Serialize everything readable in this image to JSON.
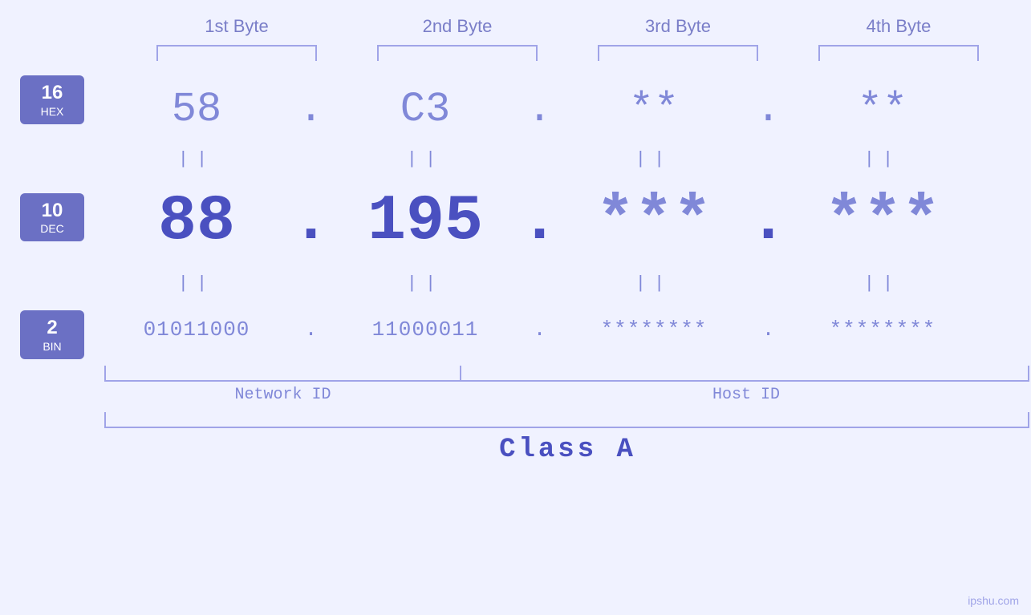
{
  "headers": {
    "byte1": "1st Byte",
    "byte2": "2nd Byte",
    "byte3": "3rd Byte",
    "byte4": "4th Byte"
  },
  "bases": {
    "hex": {
      "number": "16",
      "label": "HEX"
    },
    "dec": {
      "number": "10",
      "label": "DEC"
    },
    "bin": {
      "number": "2",
      "label": "BIN"
    }
  },
  "ip": {
    "hex": {
      "b1": "58",
      "b2": "C3",
      "b3": "**",
      "b4": "**"
    },
    "dec": {
      "b1": "88",
      "b2": "195",
      "b3": "***",
      "b4": "***"
    },
    "bin": {
      "b1": "01011000",
      "b2": "11000011",
      "b3": "********",
      "b4": "********"
    }
  },
  "labels": {
    "network_id": "Network ID",
    "host_id": "Host ID",
    "class": "Class A"
  },
  "watermark": "ipshu.com"
}
